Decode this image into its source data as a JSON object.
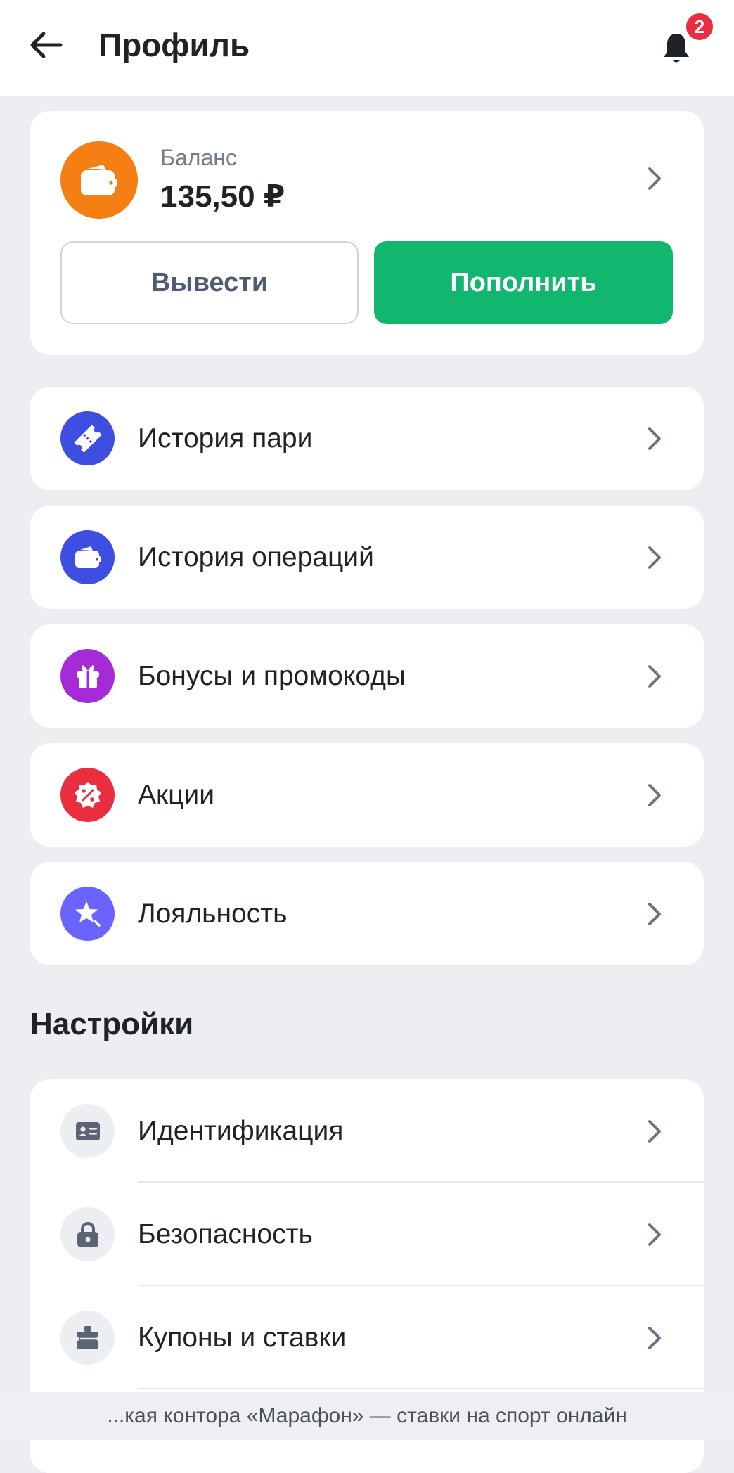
{
  "header": {
    "title": "Профиль",
    "notification_count": "2"
  },
  "balance": {
    "label": "Баланс",
    "value": "135,50 ₽",
    "withdraw_label": "Вывести",
    "deposit_label": "Пополнить"
  },
  "menu": [
    {
      "label": "История пари",
      "icon": "ticket-icon",
      "color": "#3d4ee0"
    },
    {
      "label": "История операций",
      "icon": "wallet-icon",
      "color": "#3d4ee0"
    },
    {
      "label": "Бонусы и промокоды",
      "icon": "gift-icon",
      "color": "#a62bd8"
    },
    {
      "label": "Акции",
      "icon": "percent-badge-icon",
      "color": "#ea2d3f"
    },
    {
      "label": "Лояльность",
      "icon": "star-icon",
      "color": "#6b63ff"
    }
  ],
  "settings": {
    "title": "Настройки",
    "items": [
      {
        "label": "Идентификация",
        "icon": "id-card-icon"
      },
      {
        "label": "Безопасность",
        "icon": "lock-icon"
      },
      {
        "label": "Купоны и ставки",
        "icon": "coupon-icon"
      }
    ]
  },
  "footer": {
    "caption": "...кая контора «Марафон» — ставки на спорт онлайн"
  },
  "colors": {
    "accent_green": "#12b76f",
    "balance_orange": "#f57f12",
    "badge_red": "#ea2d3f",
    "background": "#eceef2",
    "icon_gray": "#5b6374"
  }
}
